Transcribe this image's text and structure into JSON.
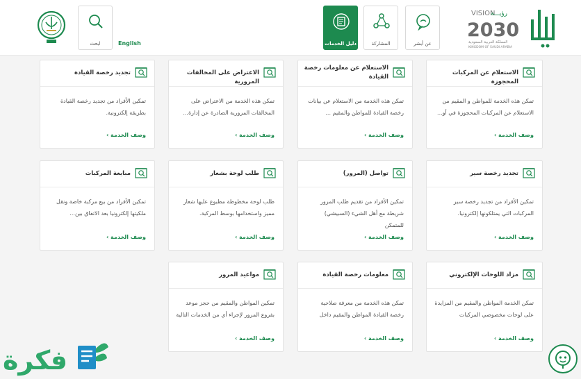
{
  "header": {
    "vision_text": "VISION",
    "vision_year": "2030",
    "vision_arabic": "رؤيـــة",
    "vision_sub": "المملكة العربية السعودية",
    "vision_sub_en": "KINGDOM OF SAUDI ARABIA",
    "nav": [
      {
        "label": "عن أبشر",
        "icon": "info-chat-icon"
      },
      {
        "label": "المشاركة",
        "icon": "share-icon"
      },
      {
        "label": "دليل الخدمات",
        "icon": "book-icon",
        "active": true
      },
      {
        "label": "ابحث",
        "icon": "search-icon"
      }
    ],
    "english_label": "English"
  },
  "cards": [
    {
      "title": "الاستعلام عن المركبات المحجوزة",
      "desc": "تمكن هذه الخدمة للمواطن و المقيم من الاستعلام عن المركبات المحجوزة في أو...",
      "more": "وصف الخدمة ›"
    },
    {
      "title": "الاستعلام عن معلومات رخصة القيادة",
      "desc": "تمكن هذه الخدمة من الاستعلام عن بيانات رخصة القيادة للمواطن والمقيم ...",
      "more": "وصف الخدمة ›"
    },
    {
      "title": "الاعتراض على المخالفات المرورية",
      "desc": "تمكن هذه الخدمة من الاعتراض على المخالفات المرورية الصادرة عن إدارة...",
      "more": "وصف الخدمة ›"
    },
    {
      "title": "تجديد رخصة القيادة",
      "desc": "تمكين الأفراد من تجديد رخصة القيادة بطريقة إلكترونية.",
      "more": "وصف الخدمة ›"
    },
    {
      "title": "تجديد رخصة سير",
      "desc": "تمكين الأفراد من تجديد رخصة سير المركبات التي يمتلكونها إلكترونيا.",
      "more": "وصف الخدمة ›"
    },
    {
      "title": "تواصل (المرور)",
      "desc": "تمكين الأفراد من تقديم طلب المرور شريطة مع أهل الشيء (السبيشي) للمتمكن",
      "more": "وصف الخدمة ›"
    },
    {
      "title": "طلب لوحة بشعار",
      "desc": "طلب لوحة مخطوطة مطبوع عليها شعار مميز واستخدامها بوسط المركبة.",
      "more": "وصف الخدمة ›"
    },
    {
      "title": "مبايعة المركبات",
      "desc": "تمكين الأفراد من بيع مركبة خاصة ونقل ملكيتها إلكترونيا بعد الاتفاق بين...",
      "more": "وصف الخدمة ›"
    },
    {
      "title": "مزاد اللوحات الإلكتروني",
      "desc": "تمكن الخدمة المواطن والمقيم من المزايدة على لوحات مخصوصي المركبات",
      "more": "وصف الخدمة ›"
    },
    {
      "title": "معلومات رخصة القيادة",
      "desc": "تمكن هذه الخدمة من معرفة صلاحية رخصة القيادة المواطن والمقيم داخل",
      "more": "وصف الخدمة ›"
    },
    {
      "title": "مواعيد المرور",
      "desc": "تمكين المواطن والمقيم من حجز موعد بفروع المرور لإجراء أي من الخدمات التالية",
      "more": "وصف الخدمة ›"
    }
  ],
  "brand": {
    "text": "فكرة"
  },
  "colors": {
    "accent": "#1d8a4f",
    "brand_green": "#2fa86a",
    "brand_blue": "#1f8ec7"
  }
}
